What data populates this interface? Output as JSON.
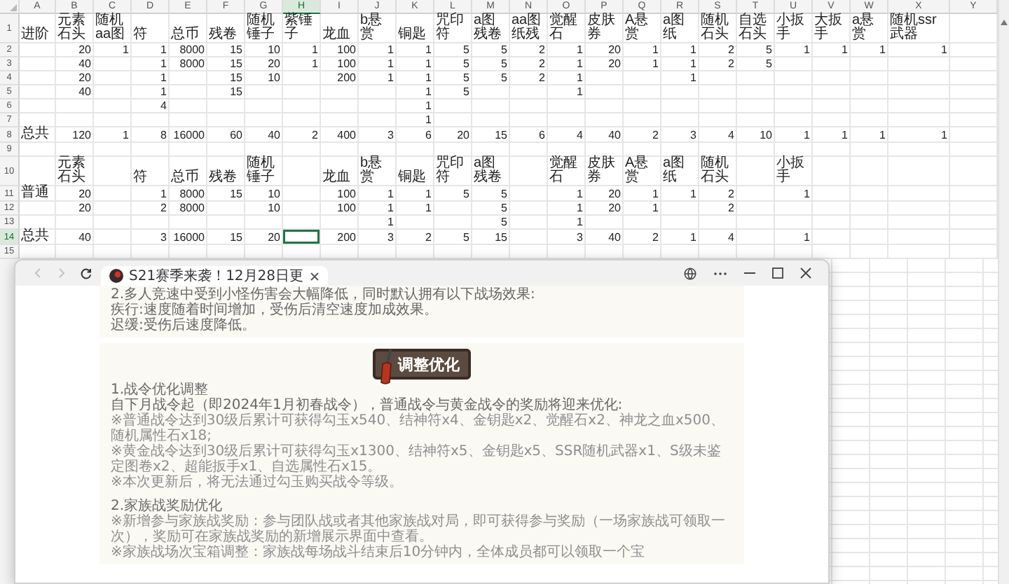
{
  "sheet": {
    "columns": [
      {
        "label": "A",
        "selected": false
      },
      {
        "label": "B",
        "selected": false
      },
      {
        "label": "C",
        "selected": false
      },
      {
        "label": "D",
        "selected": false
      },
      {
        "label": "E",
        "selected": false
      },
      {
        "label": "F",
        "selected": false
      },
      {
        "label": "G",
        "selected": false
      },
      {
        "label": "H",
        "selected": true
      },
      {
        "label": "I",
        "selected": false
      },
      {
        "label": "J",
        "selected": false
      },
      {
        "label": "K",
        "selected": false
      },
      {
        "label": "L",
        "selected": false
      },
      {
        "label": "M",
        "selected": false
      },
      {
        "label": "N",
        "selected": false
      },
      {
        "label": "O",
        "selected": false
      },
      {
        "label": "P",
        "selected": false
      },
      {
        "label": "Q",
        "selected": false
      },
      {
        "label": "R",
        "selected": false
      },
      {
        "label": "S",
        "selected": false
      },
      {
        "label": "T",
        "selected": false
      },
      {
        "label": "U",
        "selected": false
      },
      {
        "label": "V",
        "selected": false
      },
      {
        "label": "W",
        "selected": false
      },
      {
        "label": "X",
        "selected": false
      },
      {
        "label": "Y",
        "selected": false
      }
    ],
    "rows": [
      {
        "number": "1",
        "kind": "labels",
        "selected": false,
        "cells": [
          "进阶",
          "元素石头",
          "随机aa图",
          "符",
          "总币",
          "残卷",
          "随机锤子",
          "紫锤子",
          "龙血",
          "b悬赏",
          "铜匙",
          "咒印符",
          "a图残卷",
          "aa图纸残",
          "觉醒石",
          "皮肤券",
          "A悬赏",
          "a图纸",
          "随机石头",
          "自选石头",
          "小扳手",
          "大扳手",
          "a悬赏",
          "随机ssr武器"
        ]
      },
      {
        "number": "2",
        "kind": "values",
        "selected": false,
        "cells": [
          null,
          "20",
          "1",
          "1",
          "8000",
          "15",
          "10",
          "1",
          "100",
          "1",
          "1",
          "5",
          "5",
          "2",
          "1",
          "20",
          "1",
          "1",
          "2",
          "5",
          "1",
          "1",
          "1",
          "1"
        ]
      },
      {
        "number": "3",
        "kind": "values",
        "selected": false,
        "cells": [
          null,
          "40",
          null,
          "1",
          "8000",
          "15",
          "20",
          "1",
          "100",
          "1",
          "1",
          "5",
          "5",
          "2",
          "1",
          "20",
          "1",
          "1",
          "2",
          "5"
        ]
      },
      {
        "number": "4",
        "kind": "values",
        "selected": false,
        "cells": [
          null,
          "20",
          null,
          "1",
          null,
          "15",
          "10",
          null,
          "200",
          "1",
          "1",
          "5",
          "5",
          "2",
          "1",
          null,
          null,
          "1"
        ]
      },
      {
        "number": "5",
        "kind": "values",
        "selected": false,
        "cells": [
          null,
          "40",
          null,
          "1",
          null,
          "15",
          null,
          null,
          null,
          null,
          "1",
          "5",
          null,
          null,
          "1"
        ]
      },
      {
        "number": "6",
        "kind": "values",
        "selected": false,
        "cells": [
          null,
          null,
          null,
          "4",
          null,
          null,
          null,
          null,
          null,
          null,
          "1"
        ]
      },
      {
        "number": "7",
        "kind": "values",
        "selected": false,
        "cells": [
          null,
          null,
          null,
          null,
          null,
          null,
          null,
          null,
          null,
          null,
          "1"
        ]
      },
      {
        "number": "8",
        "kind": "values",
        "selected": false,
        "cells": [
          "总共",
          "120",
          "1",
          "8",
          "16000",
          "60",
          "40",
          "2",
          "400",
          "3",
          "6",
          "20",
          "15",
          "6",
          "4",
          "40",
          "2",
          "3",
          "4",
          "10",
          "1",
          "1",
          "1",
          "1"
        ]
      },
      {
        "number": "9",
        "kind": "values",
        "selected": false
      },
      {
        "number": "10",
        "kind": "labels",
        "selected": false,
        "cells": [
          null,
          "元素石头",
          null,
          "符",
          "总币",
          "残卷",
          "随机锤子",
          null,
          "龙血",
          "b悬赏",
          "铜匙",
          "咒印符",
          "a图残卷",
          null,
          "觉醒石",
          "皮肤券",
          "A悬赏",
          "a图纸",
          "随机石头",
          null,
          "小扳手"
        ]
      },
      {
        "number": "11",
        "kind": "values",
        "selected": false,
        "cells": [
          "普通",
          "20",
          null,
          "1",
          "8000",
          "15",
          "10",
          null,
          "100",
          "1",
          "1",
          "5",
          "5",
          null,
          "1",
          "20",
          "1",
          "1",
          "2",
          null,
          "1"
        ]
      },
      {
        "number": "12",
        "kind": "values",
        "selected": false,
        "cells": [
          null,
          "20",
          null,
          "2",
          "8000",
          null,
          "10",
          null,
          "100",
          "1",
          "1",
          null,
          "5",
          null,
          "1",
          "20",
          "1",
          null,
          "2"
        ]
      },
      {
        "number": "13",
        "kind": "values",
        "selected": false,
        "cells": [
          null,
          null,
          null,
          null,
          null,
          null,
          null,
          null,
          null,
          "1",
          null,
          null,
          "5",
          null,
          "1"
        ]
      },
      {
        "number": "14",
        "kind": "values",
        "selected": true,
        "cells": [
          "总共",
          "40",
          null,
          "3",
          "16000",
          "15",
          "20",
          null,
          "200",
          "3",
          "2",
          "5",
          "15",
          null,
          "3",
          "40",
          "2",
          "1",
          "4",
          null,
          "1"
        ]
      },
      {
        "number": "15",
        "kind": "values",
        "selected": false
      }
    ]
  },
  "browser": {
    "navigation": [
      {
        "kind": "back",
        "disabled": true
      },
      {
        "kind": "forward",
        "disabled": true
      },
      {
        "kind": "reload",
        "disabled": false
      }
    ],
    "tabs": [
      {
        "title": "S21赛季来袭！12月28日更",
        "selected": true
      }
    ],
    "cards": [
      {
        "sections": [
          {
            "paragraphs": [
              {
                "kind": "text",
                "text": "2.多人竞速中受到小怪伤害会大幅降低，同时默认拥有以下战场效果:"
              },
              {
                "kind": "text",
                "text": "疾行:速度随着时间增加，受伤后清空速度加成效果。"
              },
              {
                "kind": "text",
                "text": "迟缓:受伤后速度降低。"
              }
            ]
          }
        ]
      },
      {
        "banner": "调整优化",
        "sections": [
          {
            "paragraphs": [
              {
                "kind": "heading",
                "text": "1.战令优化调整"
              },
              {
                "kind": "text",
                "text": "自下月战令起（即2024年1月初春战令），普通战令与黄金战令的奖励将迎来优化:"
              },
              {
                "kind": "note",
                "text": "※普通战令达到30级后累计可获得勾玉x540、结神符x4、金钥匙x2、觉醒石x2、神龙之血x500、随机属性石x18;"
              },
              {
                "kind": "note",
                "text": "※黄金战令达到30级后累计可获得勾玉x1300、结神符x5、金钥匙x5、SSR随机武器x1、S级未鉴定图卷x2、超能扳手x1、自选属性石x15。"
              },
              {
                "kind": "note",
                "text": "※本次更新后，将无法通过勾玉购买战令等级。"
              }
            ]
          },
          {
            "paragraphs": [
              {
                "kind": "heading",
                "text": "2.家族战奖励优化"
              },
              {
                "kind": "note",
                "text": "※新增参与家族战奖励：参与团队战或者其他家族战对局，即可获得参与奖励（一场家族战可领取一次），奖励可在家族战奖励的新增展示界面中查看。"
              },
              {
                "kind": "note",
                "text": "※家族战场次宝箱调整：家族战每场战斗结束后10分钟内，全体成员都可以领取一个宝"
              }
            ]
          }
        ]
      }
    ]
  }
}
